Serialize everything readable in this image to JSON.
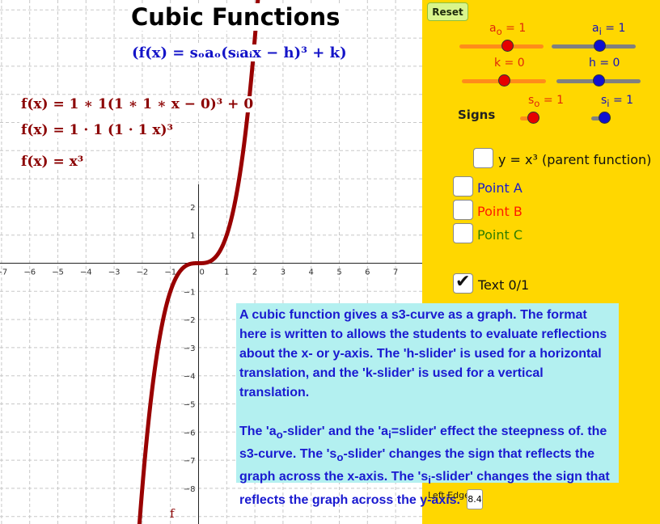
{
  "title": "Cubic Functions",
  "general_formula": "(f(x) = sₒaₒ(sᵢaᵢx − h)³ + k)",
  "equations": [
    "f(x) = 1 ∗ 1(1 ∗ 1 ∗ x − 0)³ + 0",
    "f(x) = 1 · 1 (1 · 1 x)³",
    "f(x) = x³"
  ],
  "graph": {
    "x_tick_labels": [
      "−7",
      "−6",
      "−5",
      "−4",
      "−3",
      "−2",
      "−1",
      "0",
      "1",
      "2",
      "3",
      "4",
      "5",
      "6",
      "7"
    ],
    "y_tick_labels": [
      "2",
      "1",
      "−1",
      "−2",
      "−3",
      "−4",
      "−5",
      "−6",
      "−7",
      "−8"
    ],
    "function_label": "f",
    "curve_color": "#990000",
    "function_expr": "x^3"
  },
  "controls": {
    "reset_label": "Reset",
    "sliders": {
      "ao": {
        "label": "a",
        "sub": "o",
        "value_text": " = 1",
        "fraction": 0.58
      },
      "ai": {
        "label": "a",
        "sub": "i",
        "value_text": " = 1",
        "fraction": 0.58
      },
      "k": {
        "label": "k = 0",
        "fraction": 0.5
      },
      "h": {
        "label": "h = 0",
        "fraction": 0.5
      },
      "so": {
        "label": "s",
        "sub": "o",
        "value_text": " = 1",
        "fraction": 1.0
      },
      "si": {
        "label": "s",
        "sub": "i",
        "value_text": " = 1",
        "fraction": 1.0
      }
    },
    "signs_label": "Signs",
    "checkboxes": {
      "parent": {
        "label": "y = x³ (parent function)",
        "checked": false
      },
      "point_a": {
        "label": "Point A",
        "checked": false,
        "color": "#1a1acc"
      },
      "point_b": {
        "label": "Point B",
        "checked": false,
        "color": "#ff1a00"
      },
      "point_c": {
        "label": "Point C",
        "checked": false,
        "color": "#2e7d00"
      },
      "text": {
        "label": "Text 0/1",
        "checked": true
      }
    },
    "left_edge_label": "Left Edge",
    "left_edge_value": "8.4"
  },
  "info": {
    "p1": "A cubic function gives a s3-curve as a graph. The format here is written to allows the students to evaluate reflections about the x- or y-axis. The 'h-slider' is used for a horizontal translation, and the 'k-slider' is used for a vertical translation.",
    "p2a": "The 'a",
    "p2a_sub": "o",
    "p2b": "-slider' and the 'a",
    "p2b_sub": "i",
    "p2c": "=slider' effect the steepness of. the s3-curve. The 's",
    "p2c_sub": "o",
    "p2d": "-slider' changes the sign that reflects the graph across the x-axis. The 's",
    "p2d_sub": "i",
    "p2e": "-slider' changes the sign that reflects the graph across the y-axis."
  },
  "colors": {
    "panel_bg": "#ffd700",
    "info_bg": "#b3f0f0",
    "info_text": "#1a1ad0",
    "slider_red": "#e60000",
    "slider_blue": "#1010d0"
  }
}
